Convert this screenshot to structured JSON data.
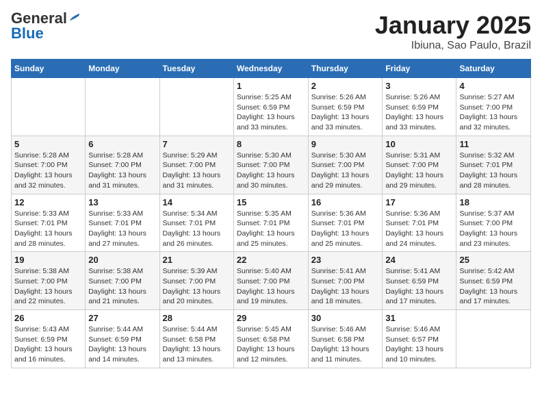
{
  "logo": {
    "general": "General",
    "blue": "Blue"
  },
  "title": "January 2025",
  "subtitle": "Ibiuna, Sao Paulo, Brazil",
  "weekdays": [
    "Sunday",
    "Monday",
    "Tuesday",
    "Wednesday",
    "Thursday",
    "Friday",
    "Saturday"
  ],
  "weeks": [
    [
      {
        "day": "",
        "info": ""
      },
      {
        "day": "",
        "info": ""
      },
      {
        "day": "",
        "info": ""
      },
      {
        "day": "1",
        "info": "Sunrise: 5:25 AM\nSunset: 6:59 PM\nDaylight: 13 hours and 33 minutes."
      },
      {
        "day": "2",
        "info": "Sunrise: 5:26 AM\nSunset: 6:59 PM\nDaylight: 13 hours and 33 minutes."
      },
      {
        "day": "3",
        "info": "Sunrise: 5:26 AM\nSunset: 6:59 PM\nDaylight: 13 hours and 33 minutes."
      },
      {
        "day": "4",
        "info": "Sunrise: 5:27 AM\nSunset: 7:00 PM\nDaylight: 13 hours and 32 minutes."
      }
    ],
    [
      {
        "day": "5",
        "info": "Sunrise: 5:28 AM\nSunset: 7:00 PM\nDaylight: 13 hours and 32 minutes."
      },
      {
        "day": "6",
        "info": "Sunrise: 5:28 AM\nSunset: 7:00 PM\nDaylight: 13 hours and 31 minutes."
      },
      {
        "day": "7",
        "info": "Sunrise: 5:29 AM\nSunset: 7:00 PM\nDaylight: 13 hours and 31 minutes."
      },
      {
        "day": "8",
        "info": "Sunrise: 5:30 AM\nSunset: 7:00 PM\nDaylight: 13 hours and 30 minutes."
      },
      {
        "day": "9",
        "info": "Sunrise: 5:30 AM\nSunset: 7:00 PM\nDaylight: 13 hours and 29 minutes."
      },
      {
        "day": "10",
        "info": "Sunrise: 5:31 AM\nSunset: 7:00 PM\nDaylight: 13 hours and 29 minutes."
      },
      {
        "day": "11",
        "info": "Sunrise: 5:32 AM\nSunset: 7:01 PM\nDaylight: 13 hours and 28 minutes."
      }
    ],
    [
      {
        "day": "12",
        "info": "Sunrise: 5:33 AM\nSunset: 7:01 PM\nDaylight: 13 hours and 28 minutes."
      },
      {
        "day": "13",
        "info": "Sunrise: 5:33 AM\nSunset: 7:01 PM\nDaylight: 13 hours and 27 minutes."
      },
      {
        "day": "14",
        "info": "Sunrise: 5:34 AM\nSunset: 7:01 PM\nDaylight: 13 hours and 26 minutes."
      },
      {
        "day": "15",
        "info": "Sunrise: 5:35 AM\nSunset: 7:01 PM\nDaylight: 13 hours and 25 minutes."
      },
      {
        "day": "16",
        "info": "Sunrise: 5:36 AM\nSunset: 7:01 PM\nDaylight: 13 hours and 25 minutes."
      },
      {
        "day": "17",
        "info": "Sunrise: 5:36 AM\nSunset: 7:01 PM\nDaylight: 13 hours and 24 minutes."
      },
      {
        "day": "18",
        "info": "Sunrise: 5:37 AM\nSunset: 7:00 PM\nDaylight: 13 hours and 23 minutes."
      }
    ],
    [
      {
        "day": "19",
        "info": "Sunrise: 5:38 AM\nSunset: 7:00 PM\nDaylight: 13 hours and 22 minutes."
      },
      {
        "day": "20",
        "info": "Sunrise: 5:38 AM\nSunset: 7:00 PM\nDaylight: 13 hours and 21 minutes."
      },
      {
        "day": "21",
        "info": "Sunrise: 5:39 AM\nSunset: 7:00 PM\nDaylight: 13 hours and 20 minutes."
      },
      {
        "day": "22",
        "info": "Sunrise: 5:40 AM\nSunset: 7:00 PM\nDaylight: 13 hours and 19 minutes."
      },
      {
        "day": "23",
        "info": "Sunrise: 5:41 AM\nSunset: 7:00 PM\nDaylight: 13 hours and 18 minutes."
      },
      {
        "day": "24",
        "info": "Sunrise: 5:41 AM\nSunset: 6:59 PM\nDaylight: 13 hours and 17 minutes."
      },
      {
        "day": "25",
        "info": "Sunrise: 5:42 AM\nSunset: 6:59 PM\nDaylight: 13 hours and 17 minutes."
      }
    ],
    [
      {
        "day": "26",
        "info": "Sunrise: 5:43 AM\nSunset: 6:59 PM\nDaylight: 13 hours and 16 minutes."
      },
      {
        "day": "27",
        "info": "Sunrise: 5:44 AM\nSunset: 6:59 PM\nDaylight: 13 hours and 14 minutes."
      },
      {
        "day": "28",
        "info": "Sunrise: 5:44 AM\nSunset: 6:58 PM\nDaylight: 13 hours and 13 minutes."
      },
      {
        "day": "29",
        "info": "Sunrise: 5:45 AM\nSunset: 6:58 PM\nDaylight: 13 hours and 12 minutes."
      },
      {
        "day": "30",
        "info": "Sunrise: 5:46 AM\nSunset: 6:58 PM\nDaylight: 13 hours and 11 minutes."
      },
      {
        "day": "31",
        "info": "Sunrise: 5:46 AM\nSunset: 6:57 PM\nDaylight: 13 hours and 10 minutes."
      },
      {
        "day": "",
        "info": ""
      }
    ]
  ]
}
